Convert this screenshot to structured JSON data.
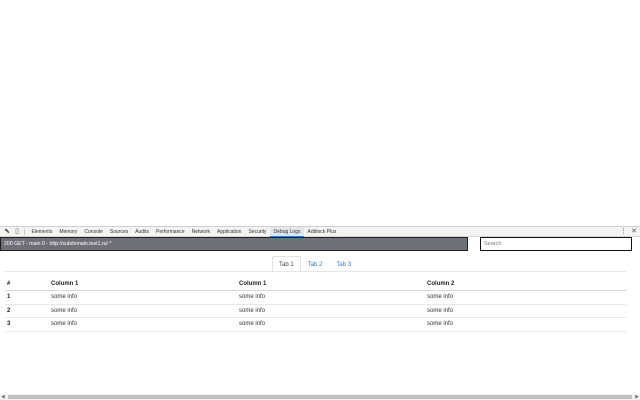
{
  "devtools": {
    "tabs": [
      "Elements",
      "Memory",
      "Console",
      "Sources",
      "Audits",
      "Performance",
      "Network",
      "Application",
      "Security",
      "Debug Logs",
      "Adblock Plus"
    ],
    "active_tab": "Debug Logs",
    "icons": {
      "inspect": "⬉",
      "device": "▯",
      "menu": "⋮",
      "close": "✕"
    }
  },
  "request": {
    "label": "200 GET - main 0 - http://subdomain.test1.ru/ *"
  },
  "search": {
    "placeholder": "Search",
    "value": ""
  },
  "panel_tabs": [
    "Tab 1",
    "Tab 2",
    "Tab 3"
  ],
  "active_panel_tab": "Tab 1",
  "table": {
    "headers": [
      "#",
      "Column 1",
      "Column 1",
      "Column 2"
    ],
    "rows": [
      [
        "1",
        "some info",
        "some info",
        "some info"
      ],
      [
        "2",
        "some info",
        "some info",
        "some info"
      ],
      [
        "3",
        "some info",
        "some info",
        "some info"
      ]
    ]
  },
  "scrollbar": {
    "left": "◀",
    "right": "▶"
  }
}
